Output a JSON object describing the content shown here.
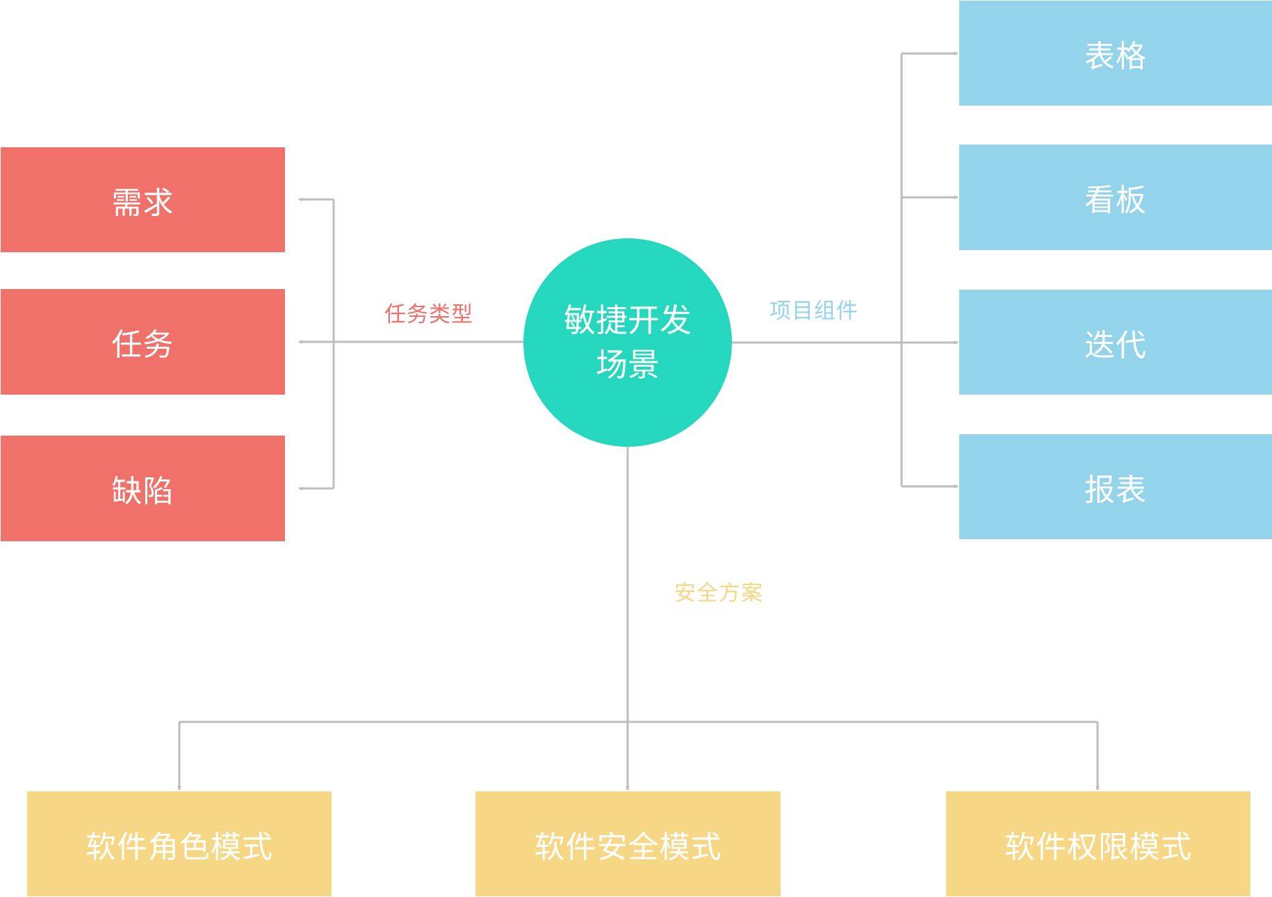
{
  "diagram": {
    "hub": {
      "line1": "敏捷开发",
      "line2": "场景",
      "color": "#24D7BD"
    },
    "connector_color": "#BDBDBD",
    "branches": {
      "task_types": {
        "label": "任务类型",
        "color": "#F0706A",
        "items": [
          "需求",
          "任务",
          "缺陷"
        ]
      },
      "project_components": {
        "label": "项目组件",
        "color": "#94D4EB",
        "items": [
          "表格",
          "看板",
          "迭代",
          "报表"
        ]
      },
      "security_schemes": {
        "label": "安全方案",
        "color": "#F6D785",
        "items": [
          "软件角色模式",
          "软件安全模式",
          "软件权限模式"
        ]
      }
    }
  }
}
